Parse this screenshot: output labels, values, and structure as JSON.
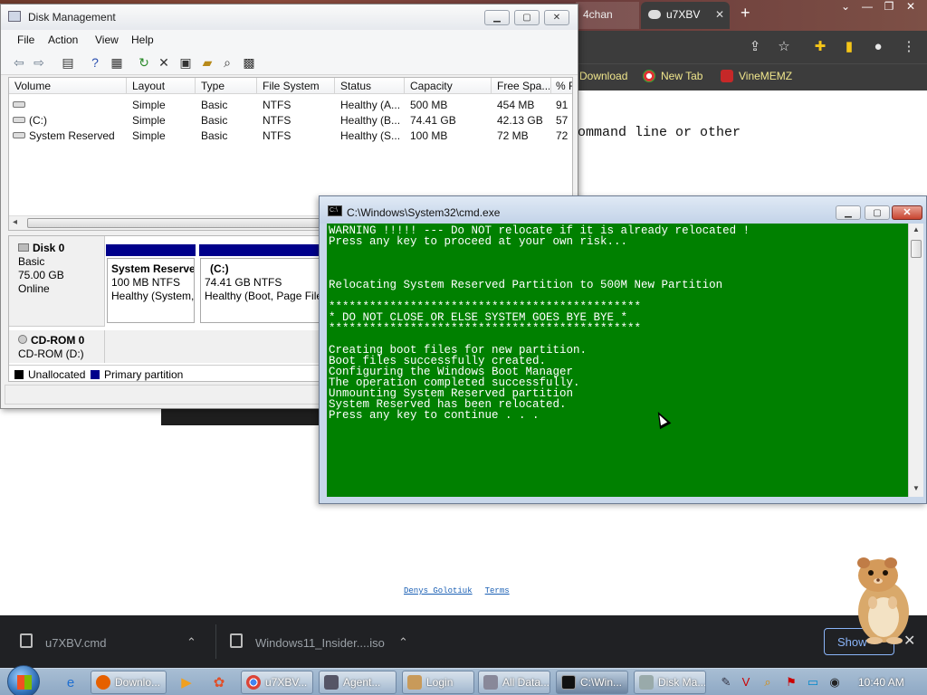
{
  "browser": {
    "tabs": [
      {
        "label": "4chan"
      },
      {
        "label": "u7XBV",
        "close": "✕"
      }
    ],
    "new_tab": "+",
    "bookmarks": [
      {
        "label": "Download",
        "icon": "download-icon"
      },
      {
        "label": "New Tab",
        "icon": "chrome-icon"
      },
      {
        "label": "VineMEMZ",
        "icon": "vine-icon"
      }
    ],
    "page_text": "ommand line or other",
    "footer_links": [
      "Denys Golotiuk",
      "Terms"
    ]
  },
  "disk_management": {
    "title": "Disk Management",
    "menu": [
      "File",
      "Action",
      "View",
      "Help"
    ],
    "columns": [
      "Volume",
      "Layout",
      "Type",
      "File System",
      "Status",
      "Capacity",
      "Free Spa...",
      "% F"
    ],
    "rows": [
      [
        "",
        "Simple",
        "Basic",
        "NTFS",
        "Healthy (A...",
        "500 MB",
        "454 MB",
        "91"
      ],
      [
        "(C:)",
        "Simple",
        "Basic",
        "NTFS",
        "Healthy (B...",
        "74.41 GB",
        "42.13 GB",
        "57"
      ],
      [
        "System Reserved",
        "Simple",
        "Basic",
        "NTFS",
        "Healthy (S...",
        "100 MB",
        "72 MB",
        "72"
      ]
    ],
    "disk0": {
      "name": "Disk 0",
      "type": "Basic",
      "size": "75.00 GB",
      "state": "Online",
      "partitions": [
        {
          "name": "System Reserve",
          "detail": "100 MB NTFS",
          "status": "Healthy (System,"
        },
        {
          "name": "(C:)",
          "detail": "74.41 GB NTFS",
          "status": "Healthy (Boot, Page File"
        }
      ]
    },
    "cdrom": {
      "name": "CD-ROM 0",
      "label": "CD-ROM (D:)"
    },
    "legend": [
      {
        "label": "Unallocated",
        "color": "#000000"
      },
      {
        "label": "Primary partition",
        "color": "#00008b"
      }
    ]
  },
  "cmd": {
    "title": "C:\\Windows\\System32\\cmd.exe",
    "background": "#008000",
    "lines": [
      "WARNING !!!!! --- Do NOT relocate if it is already relocated !",
      "Press any key to proceed at your own risk...",
      "",
      "",
      "",
      "Relocating System Reserved Partition to 500M New Partition",
      "",
      "**********************************************",
      "* DO NOT CLOSE OR ELSE SYSTEM GOES BYE BYE *",
      "**********************************************",
      "",
      "Creating boot files for new partition.",
      "Boot files successfully created.",
      "Configuring the Windows Boot Manager",
      "The operation completed successfully.",
      "Unmounting System Reserved partition",
      "System Reserved has been relocated.",
      "Press any key to continue . . ."
    ]
  },
  "downloads": {
    "items": [
      {
        "label": "u7XBV.cmd"
      },
      {
        "label": "Windows11_Insider....iso"
      }
    ],
    "show_all": "Show",
    "close": "✕"
  },
  "taskbar": {
    "buttons": [
      {
        "label": "Downlo...",
        "icon": "firefox-icon"
      },
      {
        "label": "u7XBV...",
        "icon": "chrome-icon"
      },
      {
        "label": "Agent...",
        "icon": "agent-icon"
      },
      {
        "label": "Login",
        "icon": "login-icon"
      },
      {
        "label": "All Data...",
        "icon": "folder-icon"
      },
      {
        "label": "C:\\Win...",
        "icon": "cmd-icon"
      },
      {
        "label": "Disk Ma...",
        "icon": "disk-icon"
      }
    ],
    "clock": "10:40 AM"
  }
}
